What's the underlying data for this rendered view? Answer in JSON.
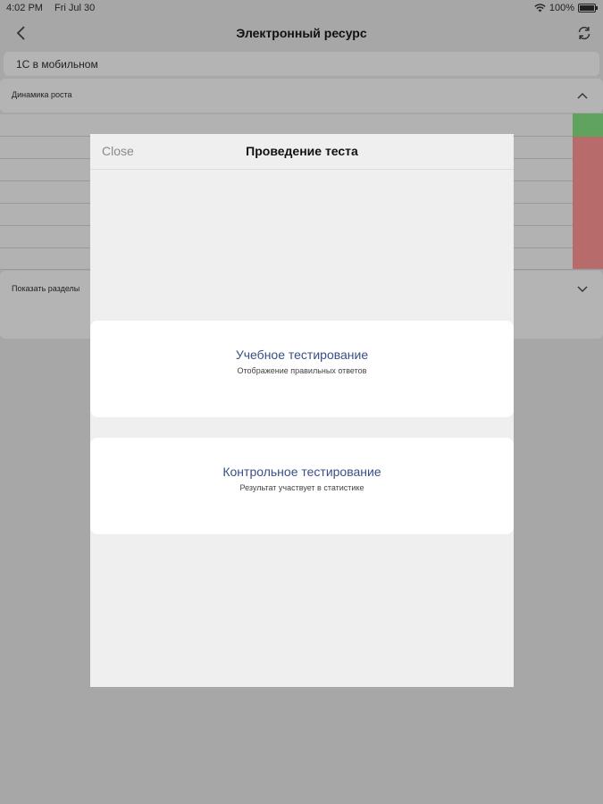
{
  "status": {
    "time": "4:02 PM",
    "date": "Fri Jul 30",
    "battery": "100%"
  },
  "nav": {
    "title": "Электронный ресурс",
    "back_icon": "chevron-left-icon",
    "refresh_icon": "refresh-icon"
  },
  "background": {
    "resource_name": "1С в мобильном",
    "growth_label": "Динамика роста",
    "sections_label": "Показать разделы"
  },
  "modal": {
    "close_label": "Close",
    "title": "Проведение теста",
    "options": [
      {
        "title": "Учебное тестирование",
        "subtitle": "Отображение правильных ответов"
      },
      {
        "title": "Контрольное тестирование",
        "subtitle": "Результат участвует в статистике"
      }
    ]
  },
  "colors": {
    "accent": "#3a4f86",
    "chart_green": "#5fa35f",
    "chart_red": "#b76b6b",
    "overlay": "#a7a7a7"
  }
}
